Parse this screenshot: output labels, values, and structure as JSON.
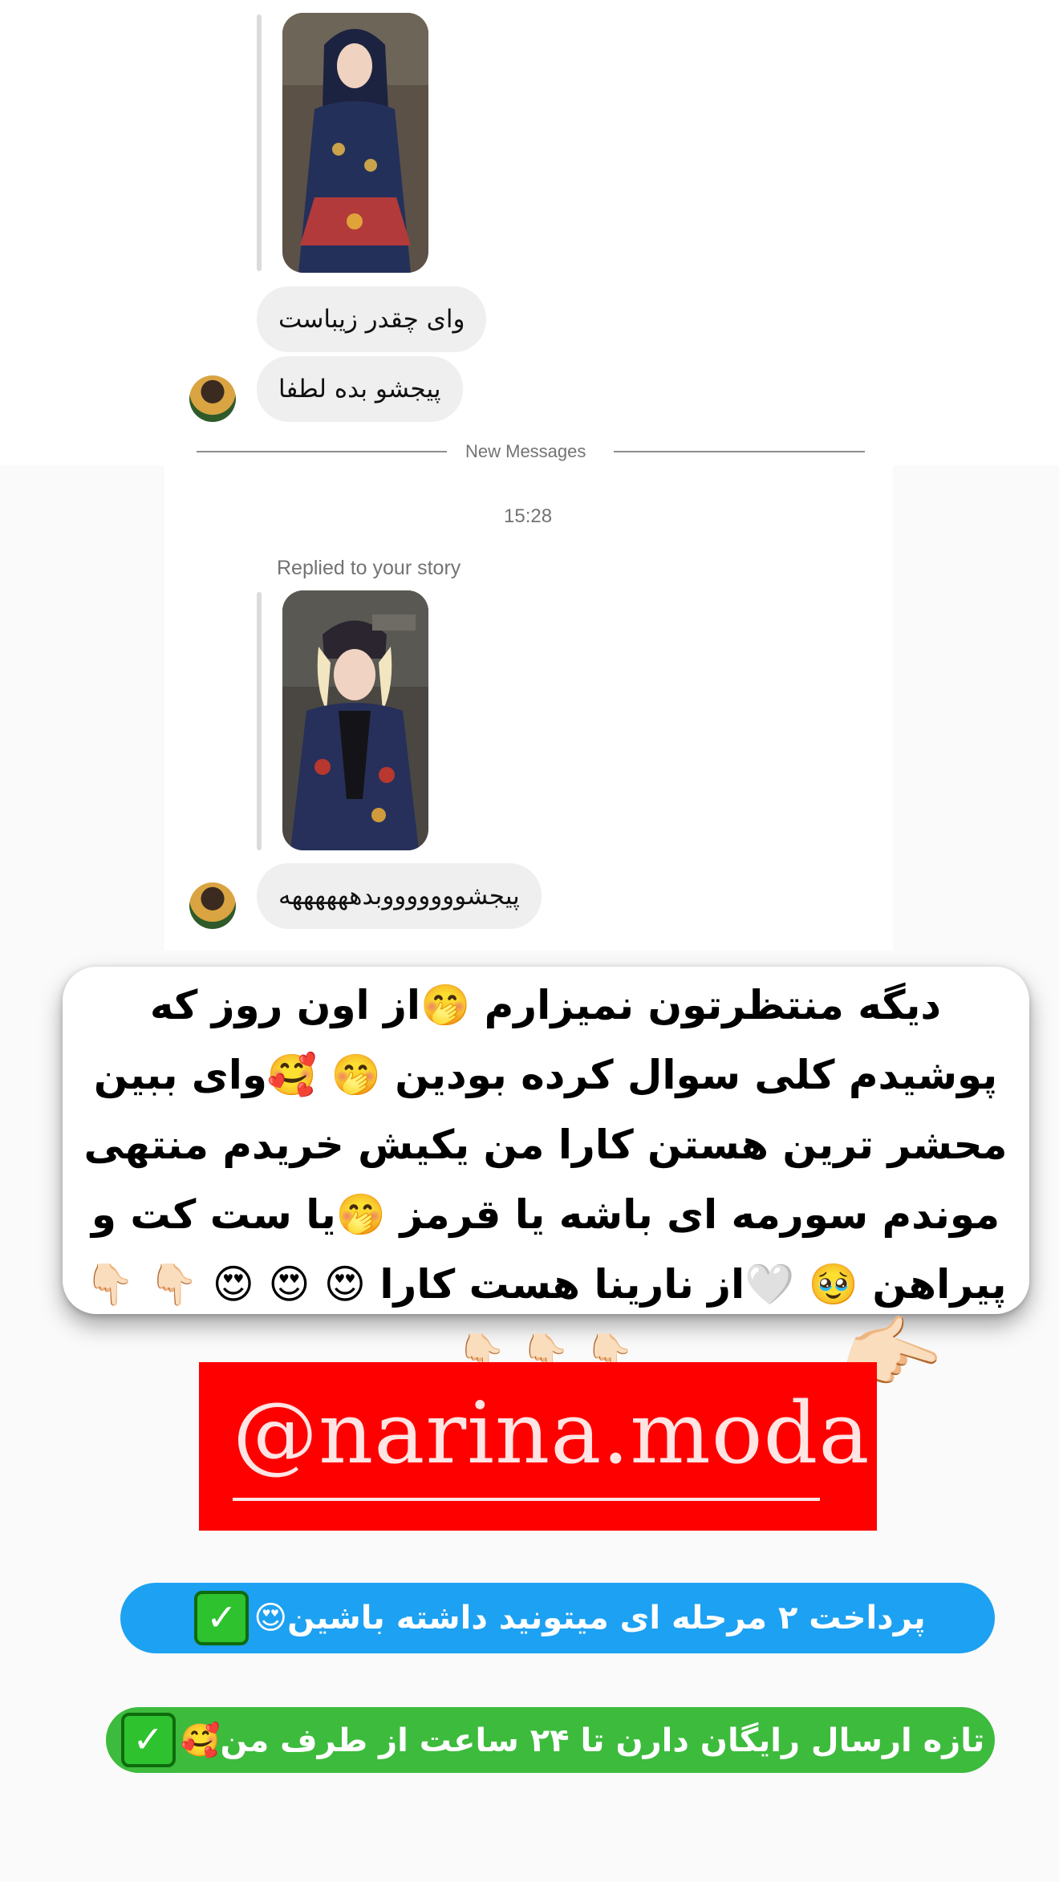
{
  "conversation": {
    "first_story_reply": {
      "messages": [
        "وای چقدر زیباست",
        "پیجشو بده لطفا"
      ]
    },
    "divider_label": "New Messages",
    "timestamp": "15:28",
    "second_story_reply": {
      "replied_label": "Replied to your story",
      "message": "پیجشوووووووبدههههههه"
    }
  },
  "caption": {
    "text": "دیگه منتظرتون نمیزارم 🤭از اون روز که پوشیدم کلی سوال کرده بودین 🤭 🥰وای ببین محشر ترین هستن کارا من یکیش خریدم منتهی موندم سورمه ای باشه یا قرمز 🤭یا ست کت و پیراهن 🥹 🤍از نارینا هست کارا 😍 😍 😍 👇🏻 👇🏻 👇🏻 👇🏻 👇🏻"
  },
  "pointer_emoji": "👉🏻",
  "handle": {
    "text": "@narina.moda"
  },
  "promos": [
    {
      "text": "پرداخت ۲ مرحله ای میتونید داشته باشین😍",
      "check": "✓",
      "color": "#1da1f2"
    },
    {
      "text": "تازه ارسال رایگان دارن تا ۲۴ ساعت از طرف من🥰",
      "check": "✓",
      "color": "#3dbb3d"
    }
  ]
}
